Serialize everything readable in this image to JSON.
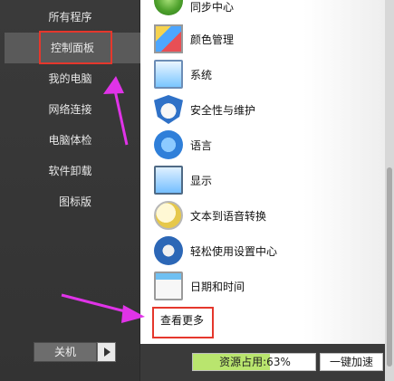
{
  "sidebar": {
    "items": [
      {
        "label": "所有程序"
      },
      {
        "label": "控制面板"
      },
      {
        "label": "我的电脑"
      },
      {
        "label": "网络连接"
      },
      {
        "label": "电脑体检"
      },
      {
        "label": "软件卸载"
      },
      {
        "label": "图标版"
      }
    ],
    "power_label": "关机"
  },
  "panel": {
    "items": [
      {
        "label": "同步中心",
        "icon": "sync-icon"
      },
      {
        "label": "颜色管理",
        "icon": "color-management-icon"
      },
      {
        "label": "系统",
        "icon": "system-icon"
      },
      {
        "label": "安全性与维护",
        "icon": "security-flag-icon"
      },
      {
        "label": "语言",
        "icon": "language-icon"
      },
      {
        "label": "显示",
        "icon": "display-icon"
      },
      {
        "label": "文本到语音转换",
        "icon": "text-to-speech-icon"
      },
      {
        "label": "轻松使用设置中心",
        "icon": "ease-of-access-icon"
      },
      {
        "label": "日期和时间",
        "icon": "calendar-icon"
      }
    ],
    "view_more": "查看更多"
  },
  "status": {
    "resource_text": "资源占用:63%",
    "resource_percent": 63,
    "accelerate_label": "一键加速"
  },
  "colors": {
    "highlight_box": "#e5372c",
    "annotation_arrow": "#e033e8",
    "resource_fill": "#b9e56e"
  }
}
